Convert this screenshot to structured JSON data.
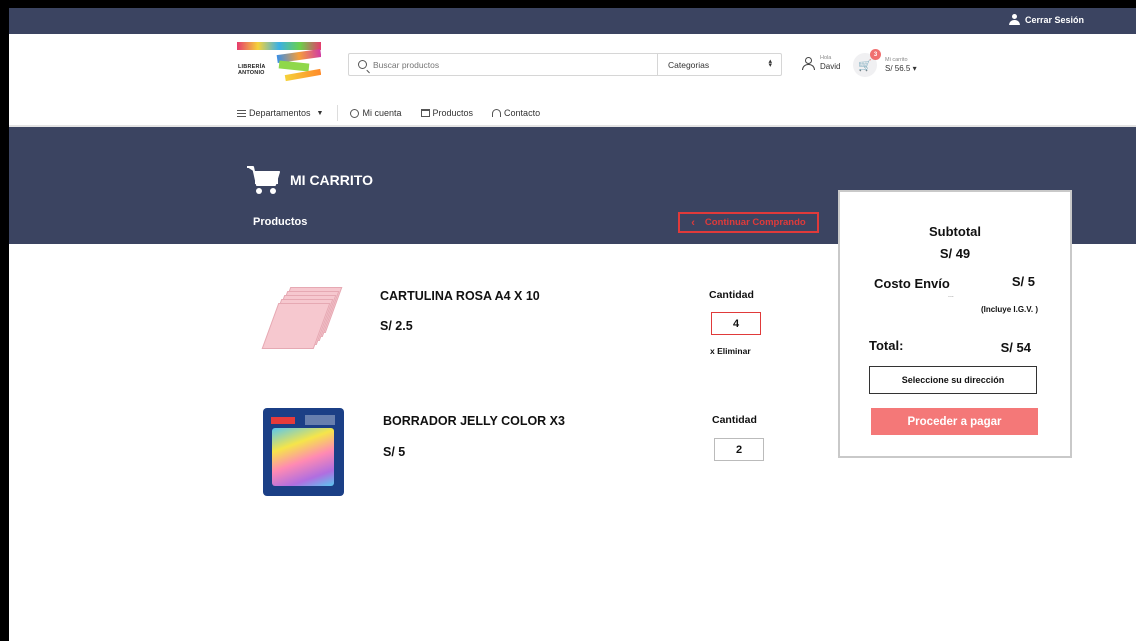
{
  "topbar": {
    "logout_label": "Cerrar Sesión"
  },
  "logo": {
    "line1": "LIBRERÍA",
    "line2": "ANTONIO"
  },
  "search": {
    "placeholder": "Buscar productos",
    "category_label": "Categorias"
  },
  "account": {
    "greeting": "Hola",
    "user_name": "David"
  },
  "cart": {
    "count": "3",
    "label": "Mi carrito",
    "total": "S/ 56.5"
  },
  "nav": {
    "departments": "Departamentos",
    "my_account": "Mi cuenta",
    "products": "Productos",
    "contact": "Contacto"
  },
  "banner": {
    "title": "MI CARRITO",
    "subtitle": "Productos",
    "continue_label": "Continuar Comprando"
  },
  "products": [
    {
      "name": "CARTULINA ROSA A4 X 10",
      "price": "S/ 2.5",
      "quantity_label": "Cantidad",
      "quantity": "4",
      "remove_label": "x Eliminar"
    },
    {
      "name": "BORRADOR JELLY COLOR X3",
      "price": "S/ 5",
      "quantity_label": "Cantidad",
      "quantity": "2"
    }
  ],
  "summary": {
    "subtotal_label": "Subtotal",
    "subtotal_value": "S/ 49",
    "shipping_label": "Costo Envío",
    "shipping_value": "S/ 5",
    "dots": "...",
    "igv_note": "(Incluye I.G.V. )",
    "total_label": "Total:",
    "total_value": "S/ 54",
    "address_label": "Seleccione su dirección",
    "pay_label": "Proceder a pagar"
  },
  "colors": {
    "navy": "#3b4461",
    "accent_red": "#e03a3a",
    "pay_button": "#f47878"
  }
}
